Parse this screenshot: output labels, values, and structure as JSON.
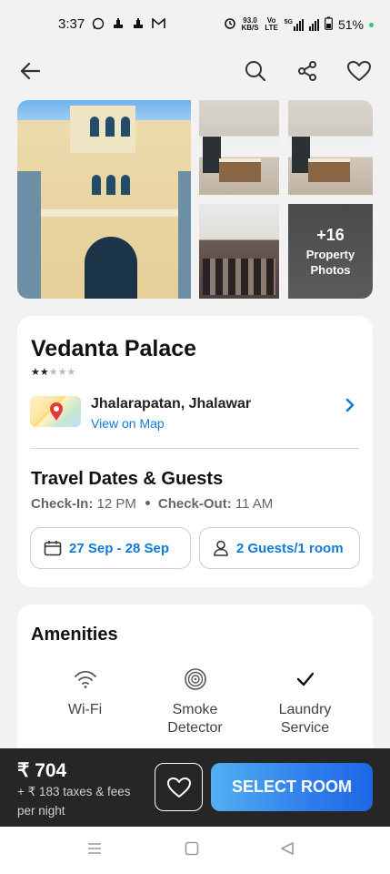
{
  "status_bar": {
    "time": "3:37",
    "speed_value": "93.0",
    "speed_unit": "KB/S",
    "volte": "Vo LTE",
    "network": "5G",
    "battery": "51%"
  },
  "gallery": {
    "more_count": "+16",
    "more_label_1": "Property",
    "more_label_2": "Photos"
  },
  "hotel": {
    "name": "Vedanta Palace",
    "stars_filled": 2,
    "stars_total": 5,
    "location": "Jhalarapatan, Jhalawar",
    "view_map": "View on Map"
  },
  "travel": {
    "title": "Travel Dates & Guests",
    "checkin_label": "Check-In:",
    "checkin_time": "12 PM",
    "checkout_label": "Check-Out:",
    "checkout_time": "11 AM",
    "dates": "27 Sep - 28 Sep",
    "guests": "2 Guests/1 room"
  },
  "amenities": {
    "title": "Amenities",
    "items": [
      {
        "label_1": "Wi-Fi",
        "label_2": "",
        "icon": "wifi-icon"
      },
      {
        "label_1": "Smoke",
        "label_2": "Detector",
        "icon": "smoke-detector-icon"
      },
      {
        "label_1": "Laundry",
        "label_2": "Service",
        "icon": "check-icon"
      }
    ]
  },
  "booking": {
    "price": "₹ 704",
    "taxes": "+ ₹ 183 taxes & fees",
    "per_night": "per night",
    "select_label": "SELECT ROOM"
  },
  "colors": {
    "accent": "#0f7ad8",
    "button_gradient_start": "#52b0f3",
    "button_gradient_end": "#1e66e6",
    "bottom_bar": "#262626"
  }
}
